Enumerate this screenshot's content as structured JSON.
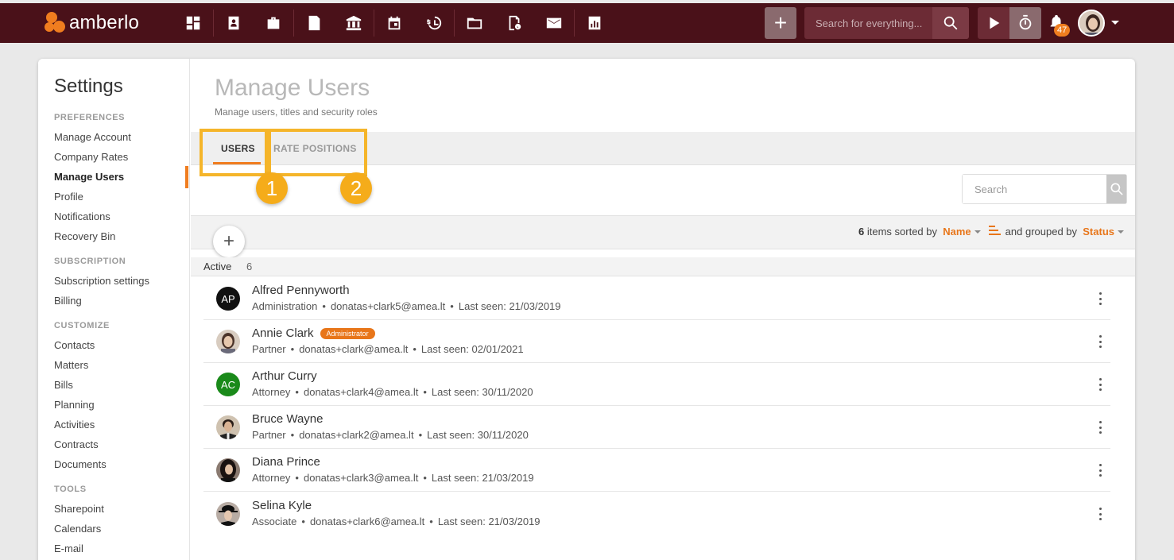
{
  "app": {
    "name": "amberlo",
    "search_placeholder": "Search for everything...",
    "notification_count": "47",
    "brand_color": "#4a1119",
    "accent_color": "#f07d1f",
    "nav_icons": [
      "dashboard-icon",
      "contacts-icon",
      "matters-icon",
      "bills-icon",
      "bank-icon",
      "calendar-icon",
      "time-money-icon",
      "folder-icon",
      "documents-icon",
      "mail-icon",
      "reports-icon"
    ]
  },
  "sidebar": {
    "title": "Settings",
    "sections": [
      {
        "label": "PREFERENCES",
        "items": [
          "Manage Account",
          "Company Rates",
          "Manage Users",
          "Profile",
          "Notifications",
          "Recovery Bin"
        ]
      },
      {
        "label": "SUBSCRIPTION",
        "items": [
          "Subscription settings",
          "Billing"
        ]
      },
      {
        "label": "CUSTOMIZE",
        "items": [
          "Contacts",
          "Matters",
          "Bills",
          "Planning",
          "Activities",
          "Contracts",
          "Documents"
        ]
      },
      {
        "label": "TOOLS",
        "items": [
          "Sharepoint",
          "Calendars",
          "E-mail"
        ]
      }
    ],
    "active_item": "Manage Users"
  },
  "page": {
    "title": "Manage Users",
    "subtitle": "Manage users, titles and security roles"
  },
  "tabs": [
    {
      "label": "USERS",
      "active": true
    },
    {
      "label": "RATE POSITIONS",
      "active": false
    }
  ],
  "callouts": [
    "1",
    "2"
  ],
  "list": {
    "search_placeholder": "Search",
    "count": "6",
    "items_sorted_by": "items sorted by",
    "sort_field": "Name",
    "grouped_by_text": "and grouped by",
    "group_field": "Status",
    "group": {
      "label": "Active",
      "count": "6"
    },
    "users": [
      {
        "name": "Alfred Pennyworth",
        "initials": "AP",
        "avatar_color": "#111111",
        "photo": false,
        "badge": "",
        "role": "Administration",
        "email": "donatas+clark5@amea.lt",
        "last_seen": "Last seen: 21/03/2019"
      },
      {
        "name": "Annie Clark",
        "initials": "",
        "avatar_color": "#b59b8a",
        "photo": true,
        "badge": "Administrator",
        "role": "Partner",
        "email": "donatas+clark@amea.lt",
        "last_seen": "Last seen: 02/01/2021"
      },
      {
        "name": "Arthur Curry",
        "initials": "AC",
        "avatar_color": "#1a8a1a",
        "photo": false,
        "badge": "",
        "role": "Attorney",
        "email": "donatas+clark4@amea.lt",
        "last_seen": "Last seen: 30/11/2020"
      },
      {
        "name": "Bruce Wayne",
        "initials": "",
        "avatar_color": "#6b5a4a",
        "photo": true,
        "badge": "",
        "role": "Partner",
        "email": "donatas+clark2@amea.lt",
        "last_seen": "Last seen: 30/11/2020"
      },
      {
        "name": "Diana Prince",
        "initials": "",
        "avatar_color": "#3a2a2a",
        "photo": true,
        "badge": "",
        "role": "Attorney",
        "email": "donatas+clark3@amea.lt",
        "last_seen": "Last seen: 21/03/2019"
      },
      {
        "name": "Selina Kyle",
        "initials": "",
        "avatar_color": "#2a2020",
        "photo": true,
        "badge": "",
        "role": "Associate",
        "email": "donatas+clark6@amea.lt",
        "last_seen": "Last seen: 21/03/2019"
      }
    ]
  }
}
